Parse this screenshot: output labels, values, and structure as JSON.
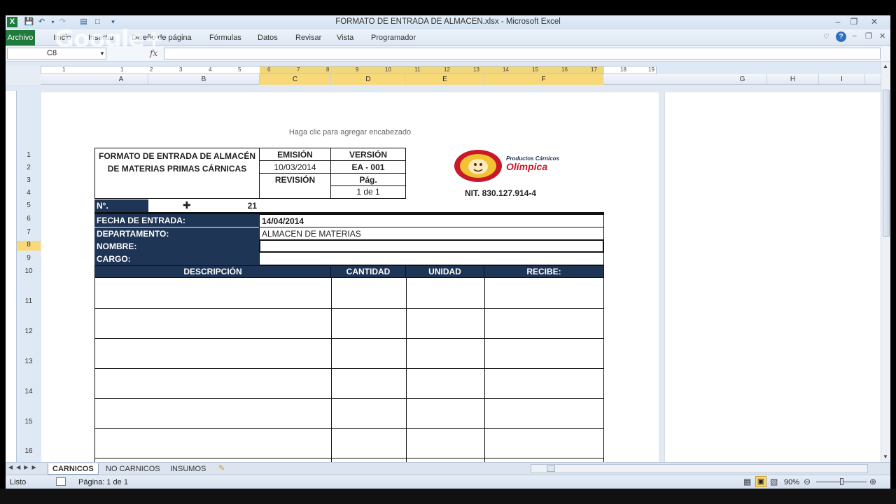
{
  "window": {
    "title": "FORMATO DE ENTRADA  DE ALMACEN.xlsx  -  Microsoft Excel"
  },
  "watermark": "Google+",
  "ribbon": {
    "file_tab": "Archivo",
    "tabs": [
      "Inicio",
      "Insertar",
      "Diseño de página",
      "Fórmulas",
      "Datos",
      "Revisar",
      "Vista",
      "Programador"
    ]
  },
  "formula_bar": {
    "name_box": "C8",
    "fx": "fx",
    "value": ""
  },
  "ruler_numbers": [
    "1",
    "1",
    "2",
    "3",
    "4",
    "5",
    "6",
    "7",
    "8",
    "9",
    "10",
    "11",
    "12",
    "13",
    "14",
    "15",
    "16",
    "17",
    "18",
    "19"
  ],
  "columns": [
    "A",
    "B",
    "C",
    "D",
    "E",
    "F",
    "G",
    "H",
    "I"
  ],
  "rows": [
    "1",
    "2",
    "3",
    "4",
    "5",
    "6",
    "7",
    "8",
    "9",
    "10",
    "11",
    "12",
    "13",
    "14",
    "15",
    "16"
  ],
  "page": {
    "header_placeholder": "Haga clic para agregar encabezado",
    "form_title": "FORMATO DE ENTRADA DE ALMACÉN DE MATERIAS PRIMAS CÁRNICAS",
    "emision_label": "EMISIÓN",
    "emision_value": "10/03/2014",
    "version_label": "VERSIÓN",
    "version_value": "EA - 001",
    "revision_label": "REVISIÓN",
    "pag_label": "Pág.",
    "pag_value": "1 de 1",
    "logo_text": "Productos Cárnicos",
    "logo_brand": "Olímpica",
    "nit": "NIT. 830.127.914-4",
    "no_label": "N°.",
    "no_value": "21",
    "fecha_label": "FECHA DE ENTRADA:",
    "fecha_value": "14/04/2014",
    "depto_label": "DEPARTAMENTO:",
    "depto_value": "ALMACEN DE MATERIAS",
    "nombre_label": "NOMBRE:",
    "nombre_value": "",
    "cargo_label": "CARGO:",
    "cargo_value": "",
    "table_headers": [
      "DESCRIPCIÓN",
      "CANTIDAD",
      "UNIDAD",
      "RECIBE:"
    ]
  },
  "sheets": [
    "CARNICOS",
    "NO CARNICOS",
    "INSUMOS"
  ],
  "active_sheet": "CARNICOS",
  "status": {
    "mode": "Listo",
    "page_info": "Página: 1 de 1",
    "zoom": "90%"
  },
  "colors": {
    "navy": "#1f3556",
    "excel_green": "#1f7a3c",
    "selection": "#f9d977"
  }
}
